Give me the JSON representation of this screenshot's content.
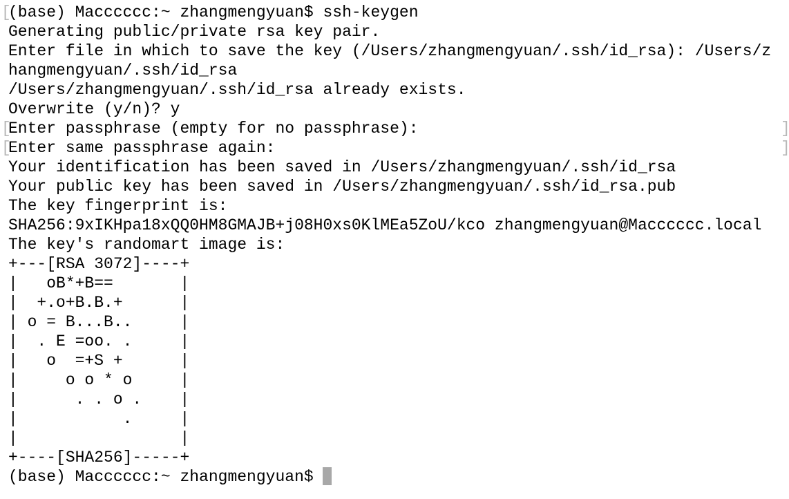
{
  "terminal": {
    "lines": [
      "(base) Macccccc:~ zhangmengyuan$ ssh-keygen",
      "Generating public/private rsa key pair.",
      "Enter file in which to save the key (/Users/zhangmengyuan/.ssh/id_rsa): /Users/z",
      "hangmengyuan/.ssh/id_rsa",
      "/Users/zhangmengyuan/.ssh/id_rsa already exists.",
      "Overwrite (y/n)? y",
      "Enter passphrase (empty for no passphrase):",
      "Enter same passphrase again:",
      "Your identification has been saved in /Users/zhangmengyuan/.ssh/id_rsa",
      "Your public key has been saved in /Users/zhangmengyuan/.ssh/id_rsa.pub",
      "The key fingerprint is:",
      "SHA256:9xIKHpa18xQQ0HM8GMAJB+j08H0xs0KlMEa5ZoU/kco zhangmengyuan@Macccccc.local",
      "The key's randomart image is:",
      "+---[RSA 3072]----+",
      "|   oB*+B==       |",
      "|  +.o+B.B.+      |",
      "| o = B...B..     |",
      "|  . E =oo. .     |",
      "|   o  =+S +      |",
      "|     o o * o     |",
      "|      . . o .    |",
      "|           .     |",
      "|                 |",
      "+----[SHA256]-----+",
      "(base) Macccccc:~ zhangmengyuan$ "
    ],
    "left_mark": "[",
    "right_mark": "]",
    "cursor_color": "#a8a8a8"
  }
}
